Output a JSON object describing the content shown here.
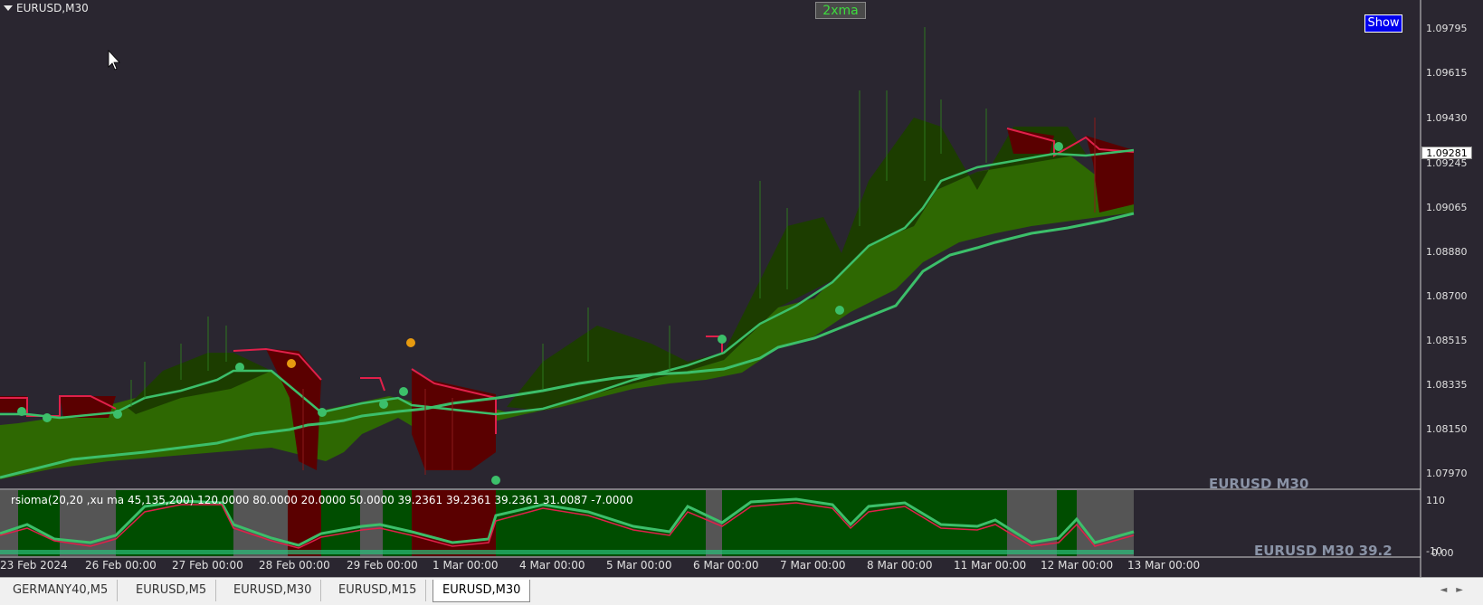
{
  "window": {
    "title": "EURUSD,M30"
  },
  "toolbar": {
    "xma_button": "2xma",
    "show_button": "Show"
  },
  "overlay": {
    "main_symbol": "EURUSD M30",
    "indicator_symbol": "EURUSD M30  39.2"
  },
  "indicator": {
    "label": "rsioma(20,20 ,xu ma 45,135,200) 120.0000 80.0000 20.0000 50.0000 39.2361 39.2361 39.2361 31.0087 -7.0000",
    "scale_top": "110",
    "scale_bottom": "-10",
    "scale_bottom2": "0.00"
  },
  "price_axis": {
    "labels": [
      "1.09795",
      "1.09615",
      "1.09430",
      "1.09245",
      "1.09065",
      "1.08880",
      "1.08700",
      "1.08515",
      "1.08335",
      "1.08150",
      "1.07970"
    ],
    "current_price": "1.09281"
  },
  "time_axis": {
    "labels": [
      "23 Feb 2024",
      "26 Feb 00:00",
      "27 Feb 00:00",
      "28 Feb 00:00",
      "29 Feb 00:00",
      "1 Mar 00:00",
      "4 Mar 00:00",
      "5 Mar 00:00",
      "6 Mar 00:00",
      "7 Mar 00:00",
      "8 Mar 00:00",
      "11 Mar 00:00",
      "12 Mar 00:00",
      "13 Mar 00:00"
    ]
  },
  "tabs": [
    {
      "label": "GERMANY40,M5",
      "active": false
    },
    {
      "label": "EURUSD,M5",
      "active": false
    },
    {
      "label": "EURUSD,M30",
      "active": false
    },
    {
      "label": "EURUSD,M15",
      "active": false
    },
    {
      "label": "EURUSD,M30",
      "active": true
    }
  ],
  "colors": {
    "bull_fill": "#2e6b00",
    "bull_dark": "#1a3c00",
    "bear_fill": "#5a0000",
    "bear_line": "#e0204a",
    "ma_line": "#3cbf6a",
    "indicator_bg": "#004d00",
    "indicator_gray": "#555555"
  }
}
